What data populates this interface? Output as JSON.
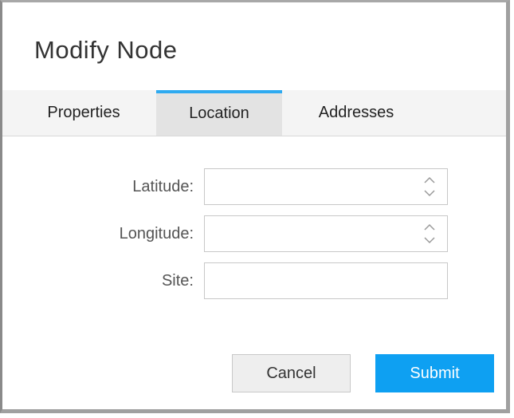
{
  "dialog": {
    "title": "Modify Node"
  },
  "tabs": [
    {
      "label": "Properties",
      "active": false
    },
    {
      "label": "Location",
      "active": true
    },
    {
      "label": "Addresses",
      "active": false
    }
  ],
  "form": {
    "latitude": {
      "label": "Latitude:",
      "value": ""
    },
    "longitude": {
      "label": "Longitude:",
      "value": ""
    },
    "site": {
      "label": "Site:",
      "value": ""
    }
  },
  "buttons": {
    "cancel_label": "Cancel",
    "submit_label": "Submit"
  },
  "icons": {
    "spinner": "spinner-icon"
  },
  "colors": {
    "accent": "#0ea0f2",
    "active_tab_indicator": "#2eaaf0"
  }
}
